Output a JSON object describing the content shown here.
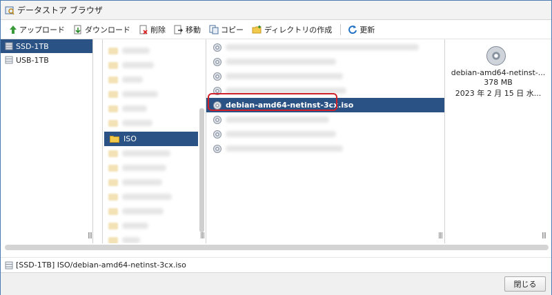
{
  "window": {
    "title": "データストア ブラウザ"
  },
  "toolbar": {
    "upload": "アップロード",
    "download": "ダウンロード",
    "delete": "削除",
    "move": "移動",
    "copy": "コピー",
    "mkdir": "ディレクトリの作成",
    "refresh": "更新"
  },
  "datastores": [
    {
      "label": "SSD-1TB",
      "selected": true
    },
    {
      "label": "USB-1TB",
      "selected": false
    }
  ],
  "folders": {
    "selected": "ISO"
  },
  "files": {
    "selected": "debian-amd64-netinst-3cx.iso"
  },
  "details": {
    "name": "debian-amd64-netinst-...",
    "size": "378 MB",
    "date": "2023 年 2 月 15 日 水..."
  },
  "pathbar": {
    "path": "[SSD-1TB] ISO/debian-amd64-netinst-3cx.iso"
  },
  "footer": {
    "close": "閉じる"
  },
  "colors": {
    "selection": "#2b5284",
    "highlight": "#d0212a",
    "window_border": "#4a7ab0"
  }
}
